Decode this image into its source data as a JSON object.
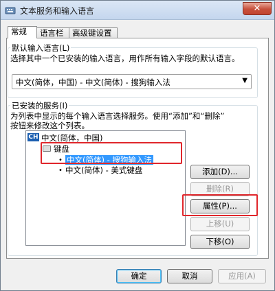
{
  "window": {
    "title": "文本服务和输入语言",
    "close_label": "✕"
  },
  "tabs": [
    {
      "label": "常规"
    },
    {
      "label": "语言栏"
    },
    {
      "label": "高级键设置"
    }
  ],
  "default_language": {
    "group_title": "默认输入语言(L)",
    "description": "选择其中一个已安装的输入语言，用作所有输入字段的默认语言。",
    "selected": "中文(简体，中国) - 中文(简体) - 搜狗输入法"
  },
  "installed_services": {
    "group_title": "已安装的服务(I)",
    "description_line1": "为列表中显示的每个输入语言选择服务。使用“添加”和“删除”",
    "description_line2": "按钮来修改这个列表。",
    "language_badge": "CH",
    "language_name": "中文(简体，中国)",
    "category": "键盘",
    "items": [
      {
        "label": "中文(简体) - 搜狗输入法",
        "selected": true
      },
      {
        "label": "中文(简体) - 美式键盘",
        "selected": false
      }
    ]
  },
  "side_buttons": {
    "add": "添加(D)...",
    "remove": "删除(R)",
    "properties": "属性(P)...",
    "move_up": "上移(U)",
    "move_down": "下移(O)"
  },
  "footer_buttons": {
    "ok": "确定",
    "cancel": "取消",
    "apply": "应用(A)"
  },
  "colors": {
    "annotation_red": "#e0262b",
    "selection_blue": "#3399ff"
  }
}
